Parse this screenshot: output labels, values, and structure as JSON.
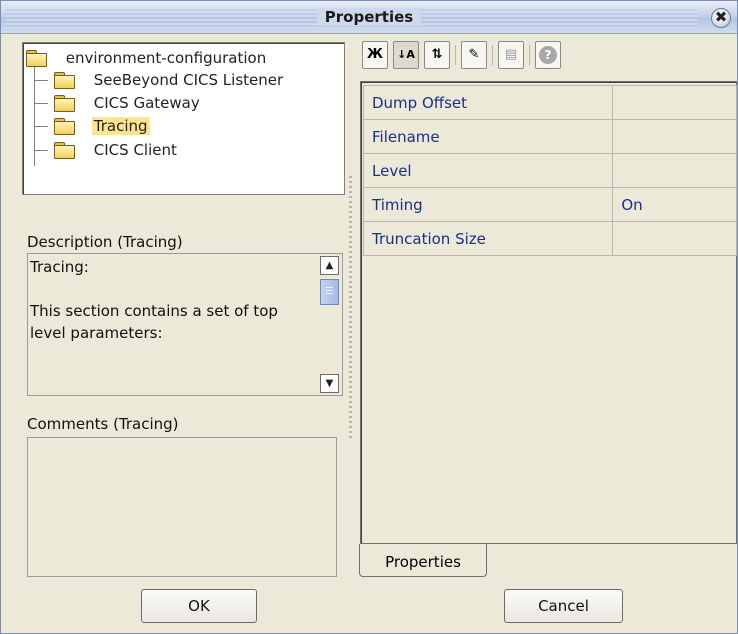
{
  "window": {
    "title": "Properties",
    "close_glyph": "✖"
  },
  "tree": {
    "root": "environment-configuration",
    "children": [
      {
        "label": "SeeBeyond CICS Listener",
        "icon": "folder-icon"
      },
      {
        "label": "CICS Gateway",
        "icon": "folder-icon"
      },
      {
        "label": "Tracing",
        "icon": "folder-icon",
        "selected": true
      },
      {
        "label": "CICS Client",
        "icon": "folder-icon"
      }
    ]
  },
  "description": {
    "label": "Description (Tracing)",
    "line1": "Tracing:",
    "line2": "This section contains a set of top level parameters:"
  },
  "comments": {
    "label": "Comments (Tracing)"
  },
  "toolbar": {
    "buttons": [
      {
        "name": "categorized-view-icon",
        "glyph": "Ж"
      },
      {
        "name": "sort-alphabetical-icon",
        "glyph": "↓A"
      },
      {
        "name": "sort-by-type-icon",
        "glyph": "⇅"
      },
      {
        "name": "edit-property-icon",
        "glyph": "✎"
      },
      {
        "name": "property-list-icon",
        "glyph": "▤"
      },
      {
        "name": "help-icon",
        "glyph": "?"
      }
    ]
  },
  "properties": {
    "rows": [
      {
        "name": "Dump Offset",
        "value": ""
      },
      {
        "name": "Filename",
        "value": ""
      },
      {
        "name": "Level",
        "value": ""
      },
      {
        "name": "Timing",
        "value": "On"
      },
      {
        "name": "Truncation Size",
        "value": ""
      }
    ],
    "tab_label": "Properties"
  },
  "buttons": {
    "ok": "OK",
    "cancel": "Cancel"
  },
  "colors": {
    "selection": "#ffe48f",
    "property_text": "#1b2e8c",
    "panel_bg": "#ece9d8"
  }
}
